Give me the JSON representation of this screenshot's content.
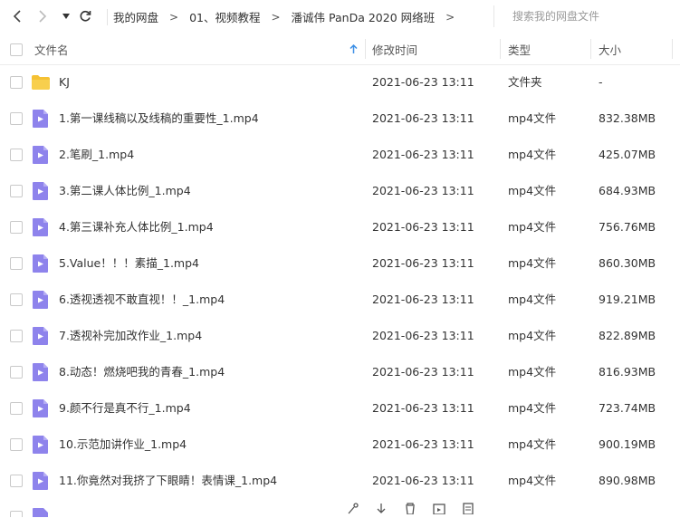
{
  "breadcrumb": {
    "items": [
      "我的网盘",
      "01、视频教程",
      "潘诚伟 PanDa 2020 网络班"
    ],
    "separator": ">"
  },
  "search": {
    "placeholder": "搜索我的网盘文件"
  },
  "columns": {
    "name": "文件名",
    "mtime": "修改时间",
    "type": "类型",
    "size": "大小"
  },
  "colors": {
    "folder": "#f5c133",
    "video": "#8e83ec",
    "sort_arrow": "#3a8ee6"
  },
  "files": [
    {
      "icon": "folder",
      "name": "KJ",
      "mtime": "2021-06-23 13:11",
      "type": "文件夹",
      "size": "-"
    },
    {
      "icon": "video",
      "name": "1.第一课线稿以及线稿的重要性_1.mp4",
      "mtime": "2021-06-23 13:11",
      "type": "mp4文件",
      "size": "832.38MB"
    },
    {
      "icon": "video",
      "name": "2.笔刷_1.mp4",
      "mtime": "2021-06-23 13:11",
      "type": "mp4文件",
      "size": "425.07MB"
    },
    {
      "icon": "video",
      "name": "3.第二课人体比例_1.mp4",
      "mtime": "2021-06-23 13:11",
      "type": "mp4文件",
      "size": "684.93MB"
    },
    {
      "icon": "video",
      "name": "4.第三课补充人体比例_1.mp4",
      "mtime": "2021-06-23 13:11",
      "type": "mp4文件",
      "size": "756.76MB"
    },
    {
      "icon": "video",
      "name": "5.Value！！！素描_1.mp4",
      "mtime": "2021-06-23 13:11",
      "type": "mp4文件",
      "size": "860.30MB"
    },
    {
      "icon": "video",
      "name": "6.透视透视不敢直视！！_1.mp4",
      "mtime": "2021-06-23 13:11",
      "type": "mp4文件",
      "size": "919.21MB"
    },
    {
      "icon": "video",
      "name": "7.透视补完加改作业_1.mp4",
      "mtime": "2021-06-23 13:11",
      "type": "mp4文件",
      "size": "822.89MB"
    },
    {
      "icon": "video",
      "name": "8.动态！燃烧吧我的青春_1.mp4",
      "mtime": "2021-06-23 13:11",
      "type": "mp4文件",
      "size": "816.93MB"
    },
    {
      "icon": "video",
      "name": "9.颜不行是真不行_1.mp4",
      "mtime": "2021-06-23 13:11",
      "type": "mp4文件",
      "size": "723.74MB"
    },
    {
      "icon": "video",
      "name": "10.示范加讲作业_1.mp4",
      "mtime": "2021-06-23 13:11",
      "type": "mp4文件",
      "size": "900.19MB"
    },
    {
      "icon": "video",
      "name": "11.你竟然对我挤了下眼睛！表情课_1.mp4",
      "mtime": "2021-06-23 13:11",
      "type": "mp4文件",
      "size": "890.98MB"
    }
  ]
}
